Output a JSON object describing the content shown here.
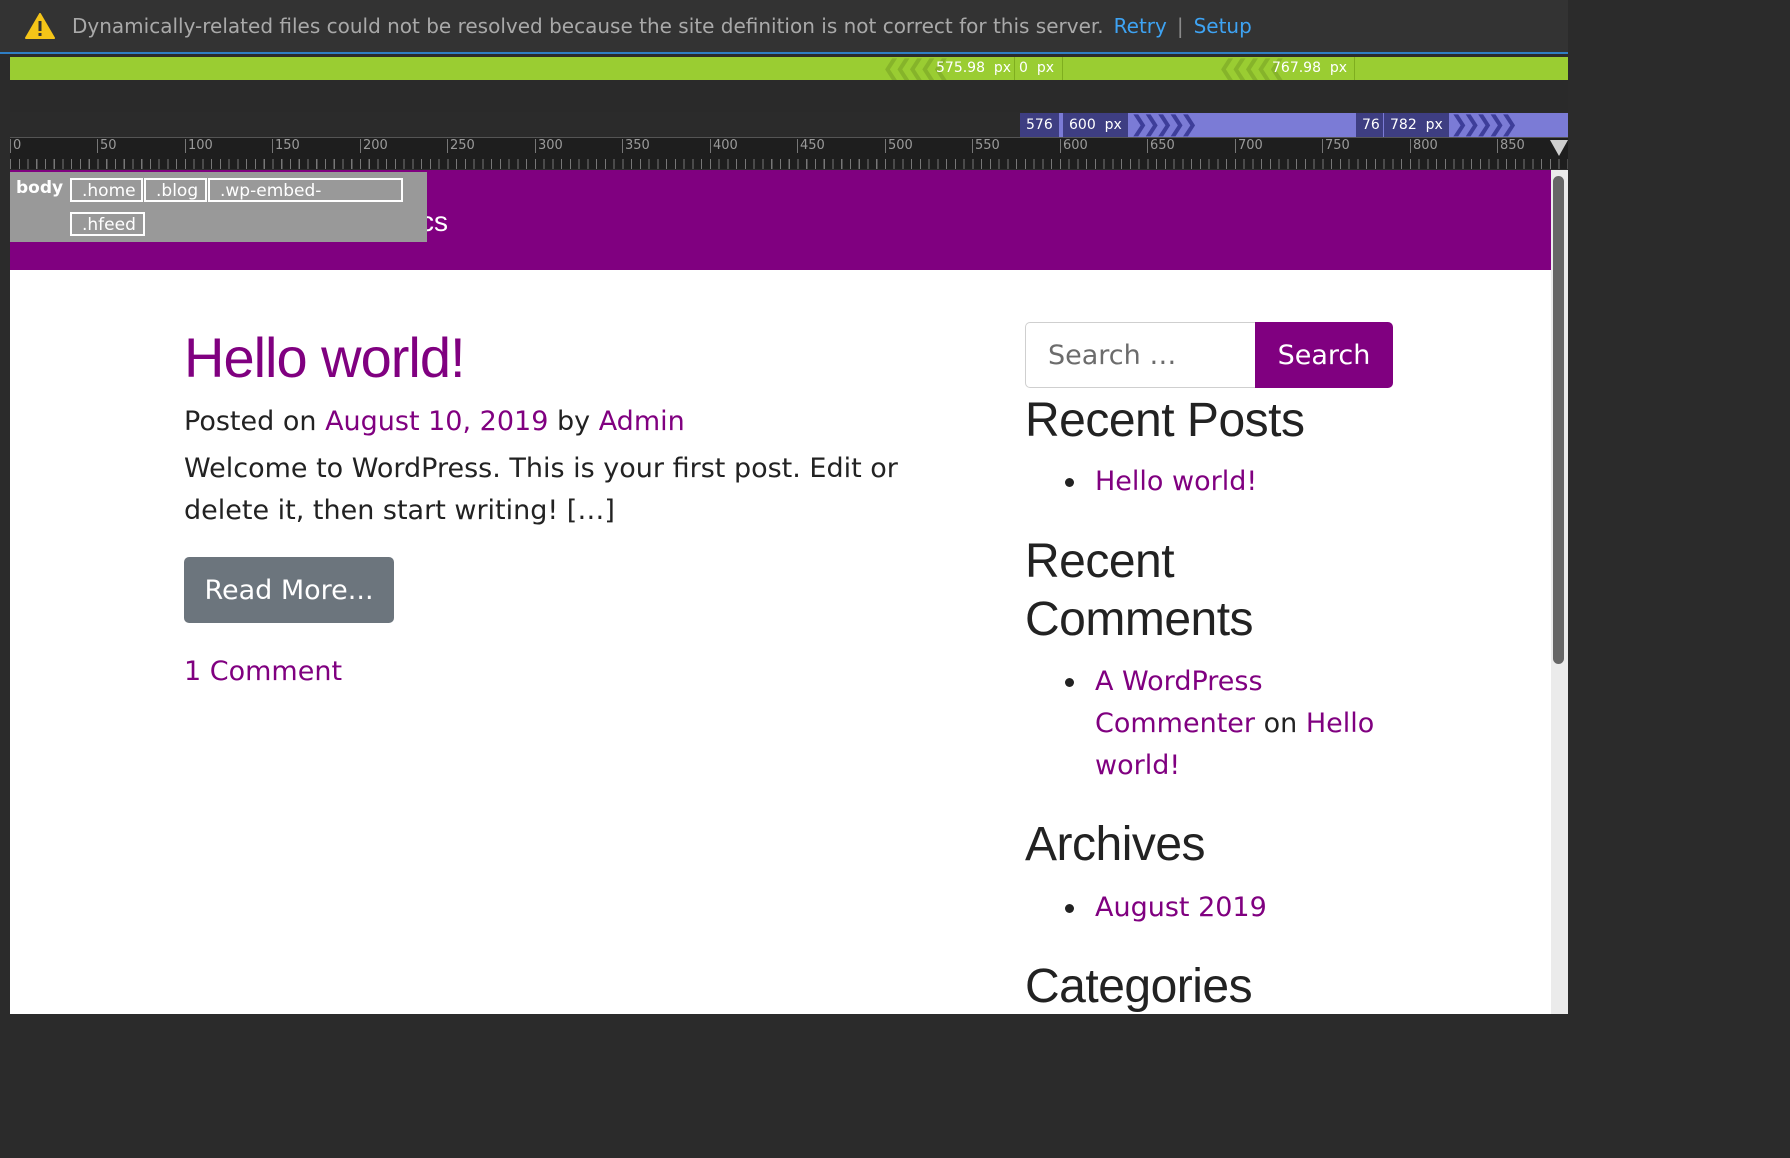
{
  "notice": {
    "message": "Dynamically-related files could not be resolved because the site definition is not correct for this server.",
    "retry_label": "Retry",
    "separator": "|",
    "setup_label": "Setup"
  },
  "media_queries": {
    "green": [
      {
        "value": "575.98",
        "unit": "px"
      },
      {
        "value": "0",
        "unit": "px"
      },
      {
        "value": "767.98",
        "unit": "px"
      }
    ],
    "purple": [
      {
        "value": "576"
      },
      {
        "value": "600",
        "unit": "px"
      },
      {
        "value": "76"
      },
      {
        "value": "782",
        "unit": "px"
      }
    ]
  },
  "ruler": {
    "ticks": [
      "0",
      "50",
      "100",
      "150",
      "200",
      "250",
      "300",
      "350",
      "400",
      "450",
      "500",
      "550",
      "600",
      "650",
      "700",
      "750",
      "800",
      "850"
    ]
  },
  "element_hud": {
    "tag": "body",
    "classes": [
      ".home",
      ".blog",
      ".wp-embed-",
      ".hfeed"
    ]
  },
  "site": {
    "title_fragment": "cs"
  },
  "post": {
    "title": "Hello world!",
    "posted_on_prefix": "Posted on",
    "date": "August 10, 2019",
    "by": "by",
    "author": "Admin",
    "excerpt": "Welcome to WordPress. This is your first post. Edit or delete it, then start writing! […]",
    "read_more": "Read More...",
    "comments": "1 Comment"
  },
  "sidebar": {
    "search_placeholder": "Search …",
    "search_button": "Search",
    "recent_posts_title": "Recent Posts",
    "recent_posts": [
      "Hello world!"
    ],
    "recent_comments_title": "Recent Comments",
    "recent_comment": {
      "author": "A WordPress Commenter",
      "on": "on",
      "post": "Hello world!"
    },
    "archives_title": "Archives",
    "archives": [
      "August 2019"
    ],
    "categories_title": "Categories"
  },
  "colors": {
    "brand": "#800080",
    "button_gray": "#6c757d",
    "link_blue": "#3ea3f3",
    "mq_green": "#9acd32",
    "mq_purple": "#7b7bd6"
  },
  "icons": {
    "notice": "warning-triangle-icon"
  }
}
